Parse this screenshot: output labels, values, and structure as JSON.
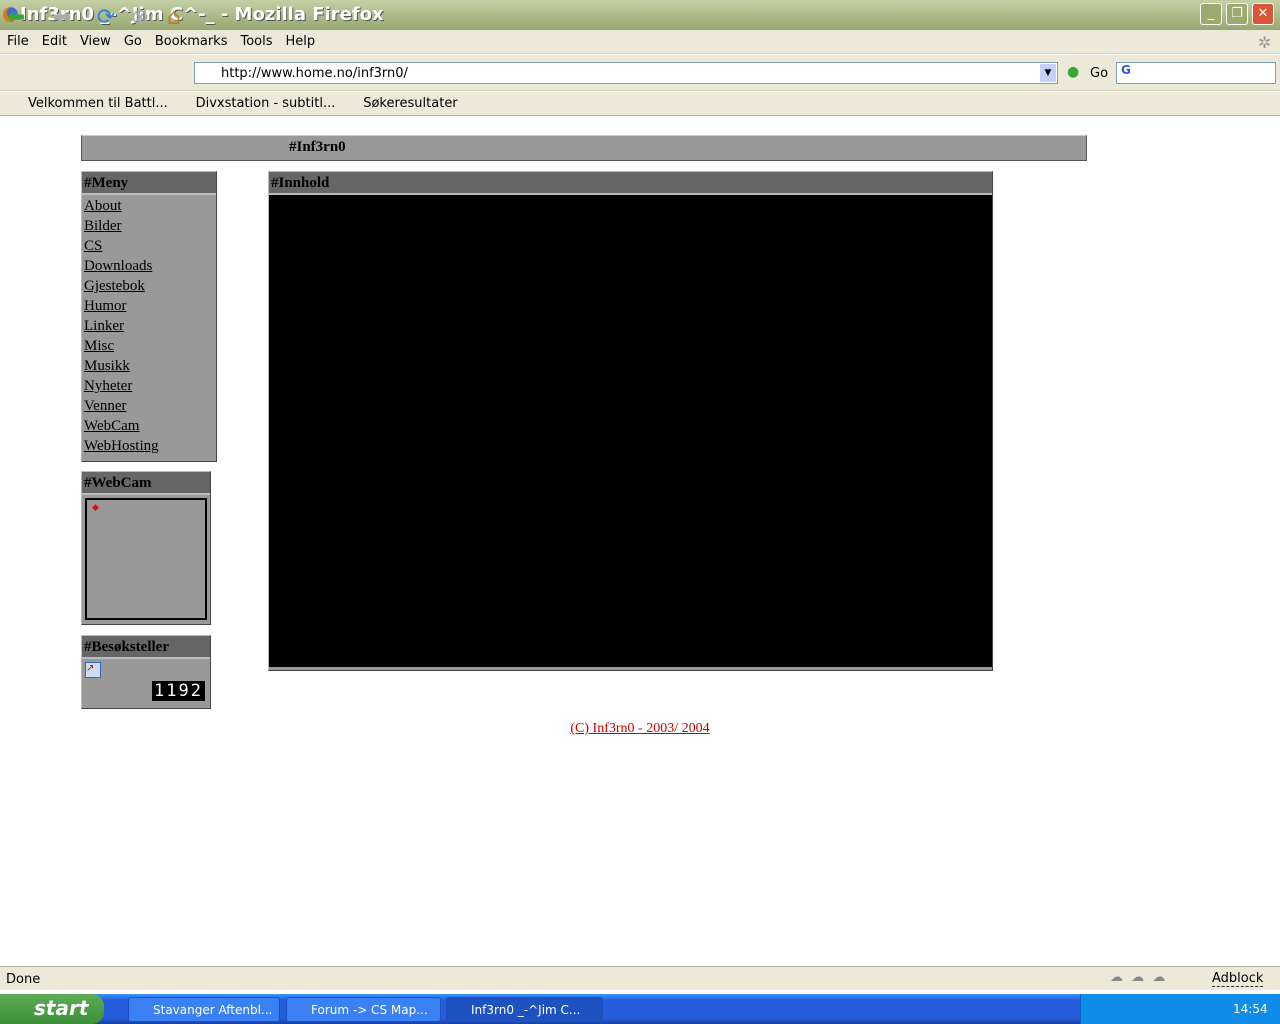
{
  "window": {
    "title": "Inf3rn0 _-^Jim C^-_ - Mozilla Firefox"
  },
  "menu": [
    "File",
    "Edit",
    "View",
    "Go",
    "Bookmarks",
    "Tools",
    "Help"
  ],
  "nav": {
    "url": "http://www.home.no/inf3rn0/",
    "go_label": "Go",
    "search_placeholder": ""
  },
  "bookmarks": [
    "Velkommen til Battl...",
    "Divxstation - subtitl...",
    "Søkeresultater"
  ],
  "page": {
    "header": "#Inf3rn0",
    "menu_title": "#Meny",
    "menu_links": [
      "About",
      "Bilder",
      "CS",
      "Downloads",
      "Gjestebok",
      "Humor",
      "Linker",
      "Misc",
      "Musikk",
      "Nyheter",
      "Venner",
      "WebCam",
      "WebHosting"
    ],
    "content_title": "#Innhold",
    "webcam_title": "#WebCam",
    "counter_title": "#Besøksteller",
    "counter_value": "1192",
    "footer": "(C) Inf3rn0 - 2003/ 2004"
  },
  "status": {
    "text": "Done",
    "adblock": "Adblock"
  },
  "taskbar": {
    "start": "start",
    "tasks": [
      "Stavanger Aftenbl...",
      "Forum -> CS Map...",
      "Inf3rn0 _-^Jim C..."
    ],
    "clock": "14:54"
  }
}
